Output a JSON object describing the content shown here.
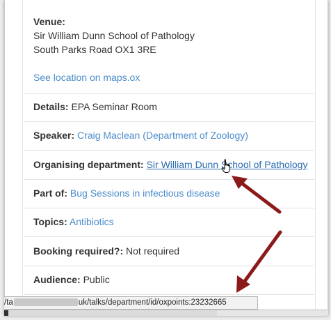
{
  "venue": {
    "label": "Venue:",
    "line1": "Sir William Dunn School of Pathology",
    "line2": "South Parks Road OX1 3RE",
    "map_link": "See location on maps.ox"
  },
  "details": {
    "label": "Details:",
    "value": " EPA Seminar Room"
  },
  "speaker": {
    "label": "Speaker:",
    "value": "Craig Maclean (Department of Zoology)"
  },
  "organising": {
    "label": "Organising department:",
    "value": "Sir William Dunn School of Pathology"
  },
  "part_of": {
    "label": "Part of:",
    "value": "Bug Sessions in infectious disease"
  },
  "topics": {
    "label": "Topics:",
    "value": "Antibiotics"
  },
  "booking": {
    "label": "Booking required?:",
    "value": " Not required"
  },
  "audience": {
    "label": "Audience:",
    "value": " Public"
  },
  "status_bar": {
    "prefix": "/ta",
    "suffix": "uk/talks/department/id/oxpoints:23232665"
  },
  "colors": {
    "link": "#4a8ccb",
    "arrow": "#8b1a1a"
  }
}
